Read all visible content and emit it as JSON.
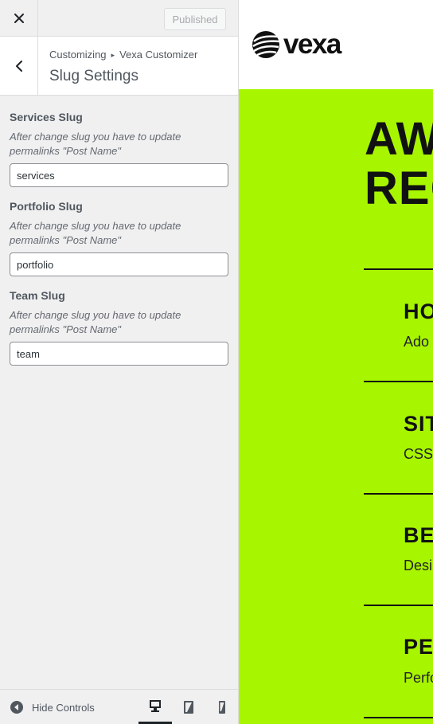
{
  "customizer": {
    "close_icon": "close-icon",
    "publish_label": "Published",
    "breadcrumb": {
      "root": "Customizing",
      "separator": "▸",
      "parent": "Vexa Customizer"
    },
    "section_title": "Slug Settings",
    "controls": [
      {
        "label": "Services Slug",
        "description": "After change slug you have to update permalinks \"Post Name\"",
        "value": "services"
      },
      {
        "label": "Portfolio Slug",
        "description": "After change slug you have to update permalinks \"Post Name\"",
        "value": "portfolio"
      },
      {
        "label": "Team Slug",
        "description": "After change slug you have to update permalinks \"Post Name\"",
        "value": "team"
      }
    ],
    "footer": {
      "hide_controls_label": "Hide Controls",
      "devices": [
        "desktop",
        "tablet",
        "mobile"
      ],
      "active_device": "desktop"
    }
  },
  "preview": {
    "logo_text": "vexa",
    "hero_bg": "#a8f500",
    "hero_title_lines": [
      "AW",
      "REC"
    ],
    "services": [
      {
        "title": "HO",
        "desc": "Ado"
      },
      {
        "title": "SIT",
        "desc": "CSS"
      },
      {
        "title": "BE",
        "desc": "Desi"
      },
      {
        "title": "PE",
        "desc": "Perfo"
      }
    ]
  }
}
